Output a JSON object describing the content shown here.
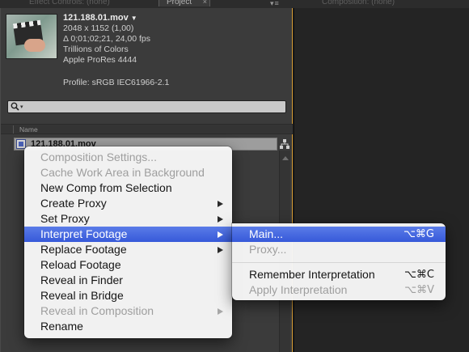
{
  "tabs": {
    "effect_controls": "Effect Controls: (none)",
    "project": "Project",
    "project_close": "×",
    "composition": "Composition: (none)"
  },
  "footage": {
    "name": "121.188.01.mov",
    "dropdown": "▼",
    "dimensions": "2048 x 1152 (1,00)",
    "duration": "Δ 0;01;02;21, 24,00 fps",
    "colors": "Trillions of Colors",
    "codec": "Apple ProRes 4444",
    "profile": "Profile: sRGB IEC61966-2.1"
  },
  "search": {
    "placeholder": "",
    "caret": "▾"
  },
  "columns": {
    "name": "Name"
  },
  "project_items": [
    {
      "name": "121.188.01.mov",
      "icon": "footage-file-icon"
    }
  ],
  "context_menu": {
    "items": [
      {
        "label": "Composition Settings...",
        "enabled": false
      },
      {
        "label": "Cache Work Area in Background",
        "enabled": false
      },
      {
        "label": "New Comp from Selection",
        "enabled": true
      },
      {
        "label": "Create Proxy",
        "enabled": true,
        "submenu": true
      },
      {
        "label": "Set Proxy",
        "enabled": true,
        "submenu": true
      },
      {
        "label": "Interpret Footage",
        "enabled": true,
        "submenu": true,
        "highlighted": true
      },
      {
        "label": "Replace Footage",
        "enabled": true,
        "submenu": true
      },
      {
        "label": "Reload Footage",
        "enabled": true
      },
      {
        "label": "Reveal in Finder",
        "enabled": true
      },
      {
        "label": "Reveal in Bridge",
        "enabled": true
      },
      {
        "label": "Reveal in Composition",
        "enabled": false,
        "submenu": true
      },
      {
        "label": "Rename",
        "enabled": true
      }
    ]
  },
  "submenu": {
    "items": [
      {
        "label": "Main...",
        "shortcut": "⌥⌘G",
        "enabled": true,
        "highlighted": true
      },
      {
        "label": "Proxy...",
        "shortcut": "",
        "enabled": false
      },
      {
        "label": "Remember Interpretation",
        "shortcut": "⌥⌘C",
        "enabled": true
      },
      {
        "label": "Apply Interpretation",
        "shortcut": "⌥⌘V",
        "enabled": false
      }
    ]
  },
  "colors": {
    "highlight": "#3a5ddb",
    "panel_border_active": "#d59a33",
    "panel_bg": "#3b3b3b"
  }
}
